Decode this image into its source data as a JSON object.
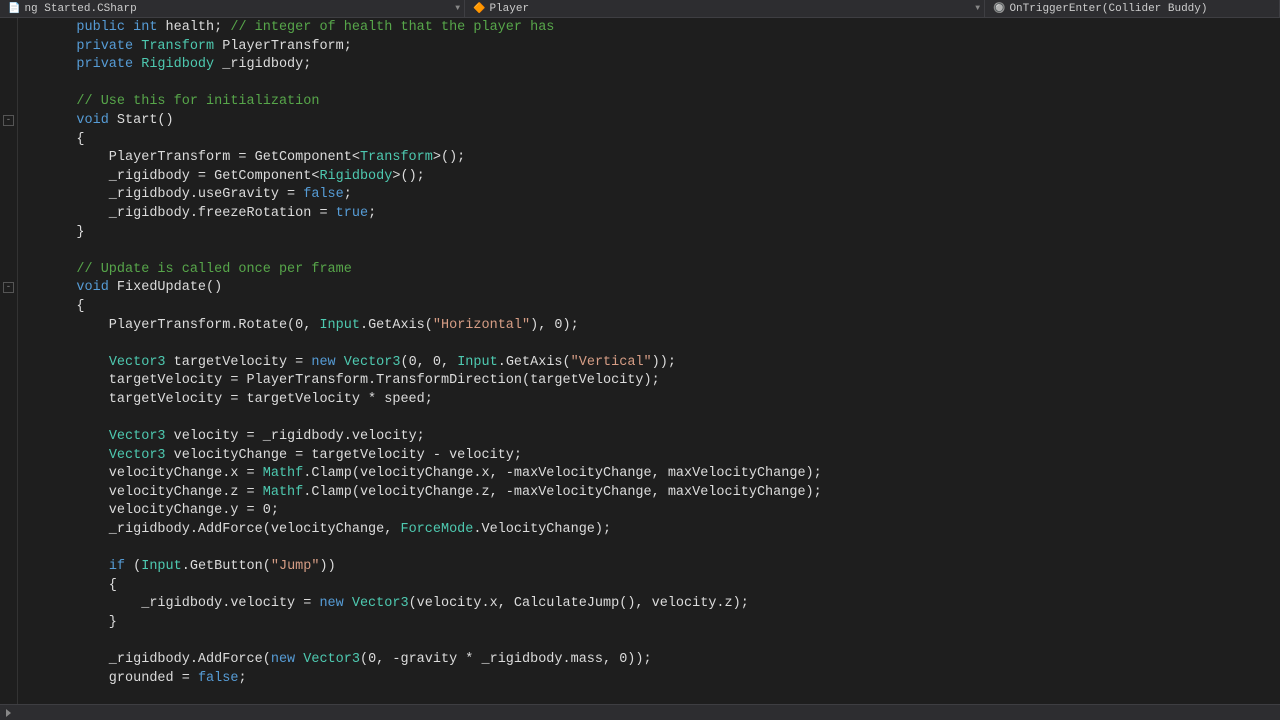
{
  "breadcrumb": {
    "project": "ng Started.CSharp",
    "class": "Player",
    "method": "OnTriggerEnter(Collider Buddy)"
  },
  "code_tokens": [
    [
      [
        "kw",
        "    public "
      ],
      [
        "kw",
        "int "
      ],
      [
        "ident",
        "health; "
      ],
      [
        "com",
        "// integer of health that the player has"
      ]
    ],
    [
      [
        "kw",
        "    private "
      ],
      [
        "type",
        "Transform "
      ],
      [
        "ident",
        "PlayerTransform;"
      ]
    ],
    [
      [
        "kw",
        "    private "
      ],
      [
        "type",
        "Rigidbody "
      ],
      [
        "ident",
        "_rigidbody;"
      ]
    ],
    [
      [
        "",
        "    "
      ]
    ],
    [
      [
        "com",
        "    // Use this for initialization"
      ]
    ],
    [
      [
        "kw",
        "    void "
      ],
      [
        "ident",
        "Start()"
      ]
    ],
    [
      [
        "punct",
        "    {"
      ]
    ],
    [
      [
        "ident",
        "        PlayerTransform = GetComponent<"
      ],
      [
        "type",
        "Transform"
      ],
      [
        "ident",
        ">();"
      ]
    ],
    [
      [
        "ident",
        "        _rigidbody = GetComponent<"
      ],
      [
        "type",
        "Rigidbody"
      ],
      [
        "ident",
        ">();"
      ]
    ],
    [
      [
        "ident",
        "        _rigidbody.useGravity = "
      ],
      [
        "lit",
        "false"
      ],
      [
        "punct",
        ";"
      ]
    ],
    [
      [
        "ident",
        "        _rigidbody.freezeRotation = "
      ],
      [
        "lit",
        "true"
      ],
      [
        "punct",
        ";"
      ]
    ],
    [
      [
        "punct",
        "    }"
      ]
    ],
    [
      [
        "",
        "    "
      ]
    ],
    [
      [
        "com",
        "    // Update is called once per frame"
      ]
    ],
    [
      [
        "kw",
        "    void "
      ],
      [
        "ident",
        "FixedUpdate()"
      ]
    ],
    [
      [
        "punct",
        "    {"
      ]
    ],
    [
      [
        "ident",
        "        PlayerTransform.Rotate(0, "
      ],
      [
        "type",
        "Input"
      ],
      [
        "ident",
        ".GetAxis("
      ],
      [
        "str",
        "\"Horizontal\""
      ],
      [
        "ident",
        "), 0);"
      ]
    ],
    [
      [
        "",
        "    "
      ]
    ],
    [
      [
        "ident",
        "        "
      ],
      [
        "type",
        "Vector3"
      ],
      [
        "ident",
        " targetVelocity = "
      ],
      [
        "kw",
        "new "
      ],
      [
        "type",
        "Vector3"
      ],
      [
        "ident",
        "(0, 0, "
      ],
      [
        "type",
        "Input"
      ],
      [
        "ident",
        ".GetAxis("
      ],
      [
        "str",
        "\"Vertical\""
      ],
      [
        "ident",
        "));"
      ]
    ],
    [
      [
        "ident",
        "        targetVelocity = PlayerTransform.TransformDirection(targetVelocity);"
      ]
    ],
    [
      [
        "ident",
        "        targetVelocity = targetVelocity * speed;"
      ]
    ],
    [
      [
        "",
        "    "
      ]
    ],
    [
      [
        "ident",
        "        "
      ],
      [
        "type",
        "Vector3"
      ],
      [
        "ident",
        " velocity = _rigidbody.velocity;"
      ]
    ],
    [
      [
        "ident",
        "        "
      ],
      [
        "type",
        "Vector3"
      ],
      [
        "ident",
        " velocityChange = targetVelocity - velocity;"
      ]
    ],
    [
      [
        "ident",
        "        velocityChange.x = "
      ],
      [
        "type",
        "Mathf"
      ],
      [
        "ident",
        ".Clamp(velocityChange.x, -maxVelocityChange, maxVelocityChange);"
      ]
    ],
    [
      [
        "ident",
        "        velocityChange.z = "
      ],
      [
        "type",
        "Mathf"
      ],
      [
        "ident",
        ".Clamp(velocityChange.z, -maxVelocityChange, maxVelocityChange);"
      ]
    ],
    [
      [
        "ident",
        "        velocityChange.y = 0;"
      ]
    ],
    [
      [
        "ident",
        "        _rigidbody.AddForce(velocityChange, "
      ],
      [
        "type",
        "ForceMode"
      ],
      [
        "ident",
        ".VelocityChange);"
      ]
    ],
    [
      [
        "",
        "    "
      ]
    ],
    [
      [
        "ident",
        "        "
      ],
      [
        "kw",
        "if "
      ],
      [
        "ident",
        "("
      ],
      [
        "type",
        "Input"
      ],
      [
        "ident",
        ".GetButton("
      ],
      [
        "str",
        "\"Jump\""
      ],
      [
        "ident",
        "))"
      ]
    ],
    [
      [
        "punct",
        "        {"
      ]
    ],
    [
      [
        "ident",
        "            _rigidbody.velocity = "
      ],
      [
        "kw",
        "new "
      ],
      [
        "type",
        "Vector3"
      ],
      [
        "ident",
        "(velocity.x, CalculateJump(), velocity.z);"
      ]
    ],
    [
      [
        "punct",
        "        }"
      ]
    ],
    [
      [
        "",
        "    "
      ]
    ],
    [
      [
        "ident",
        "        _rigidbody.AddForce("
      ],
      [
        "kw",
        "new "
      ],
      [
        "type",
        "Vector3"
      ],
      [
        "ident",
        "(0, -gravity * _rigidbody.mass, 0));"
      ]
    ],
    [
      [
        "ident",
        "        grounded = "
      ],
      [
        "lit",
        "false"
      ],
      [
        "punct",
        ";"
      ]
    ]
  ],
  "fold_marks": [
    6,
    15
  ]
}
